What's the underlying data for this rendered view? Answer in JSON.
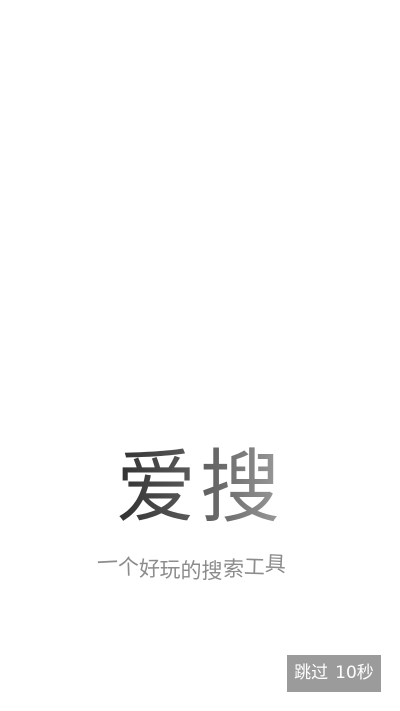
{
  "splash": {
    "app_name": "爱搜",
    "tagline": "一个好玩的搜索工具",
    "colors": {
      "background": "#ffffff",
      "tagline": "#8c8c8c",
      "skip_button_bg": "#9b9b9b",
      "skip_button_text": "#ffffff"
    }
  },
  "skip": {
    "label": "跳过",
    "countdown": "10秒"
  }
}
